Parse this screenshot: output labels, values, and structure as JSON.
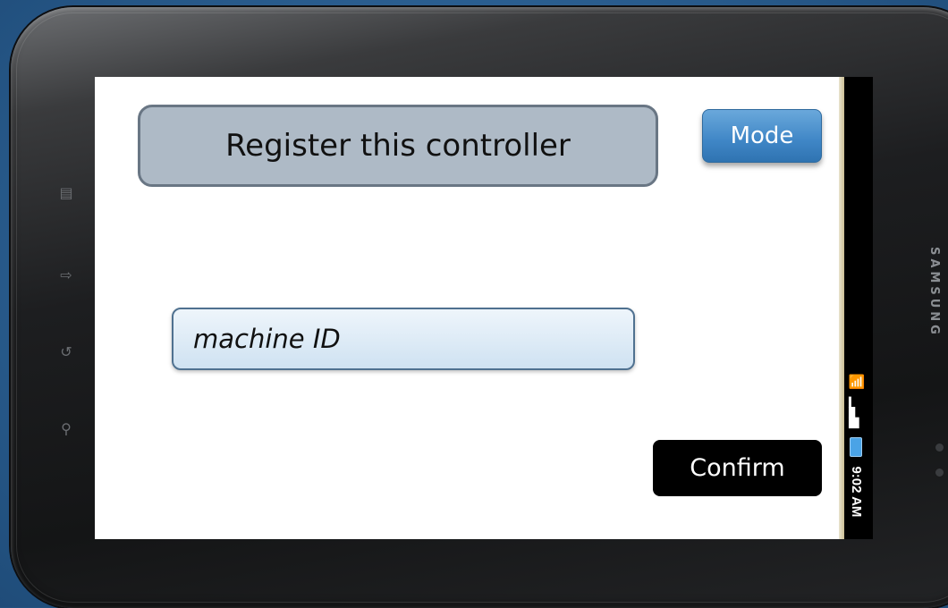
{
  "screen": {
    "title": "Register this controller",
    "mode_button": "Mode",
    "machine_id_placeholder": "machine ID",
    "confirm_button": "Confirm"
  },
  "status_bar": {
    "time": "9:02 AM",
    "icons": [
      "wifi-icon",
      "signal-icon",
      "battery-icon"
    ]
  },
  "device": {
    "hardware_keys": [
      "menu-icon",
      "home-icon",
      "back-icon",
      "search-icon"
    ],
    "brand": "SAMSUNG"
  },
  "colors": {
    "title_box": "#aebac6",
    "mode_button": "#3f86c6",
    "confirm_button": "#000000",
    "input_field": "#cfe2f2"
  }
}
